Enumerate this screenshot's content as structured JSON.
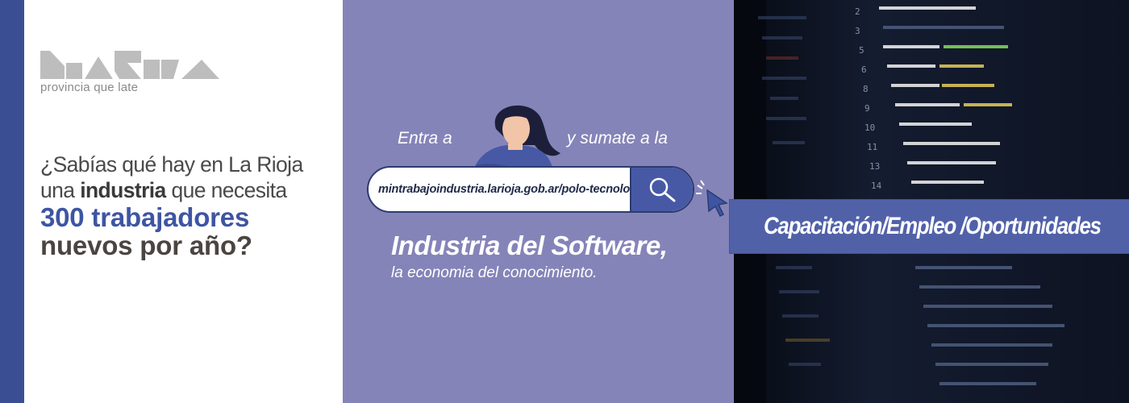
{
  "logo": {
    "name": "La Rioja",
    "tagline": "provincia que late"
  },
  "question": {
    "line1": "¿Sabías qué hay en La Rioja",
    "line2_pre": "una ",
    "line2_bold": "industria",
    "line2_post": " que necesita",
    "line3": "300 trabajadores",
    "line4": "nuevos por año?"
  },
  "cta": {
    "entra": "Entra a",
    "sumate": "y sumate a la",
    "search_url": "mintrabajoindustria.larioja.gob.ar/polo-tecnologico",
    "search_icon": "search-icon"
  },
  "industry": {
    "title": "Industria del Software,",
    "subtitle": "la economia del conocimiento."
  },
  "banner": {
    "text": "Capacitación/Empleo /Oportunidades"
  },
  "colors": {
    "stripe": "#3a4f93",
    "mid_panel": "#8584b9",
    "accent_blue": "#3d55a3",
    "banner": "#5161a8",
    "code_bg": "#0f1524"
  }
}
